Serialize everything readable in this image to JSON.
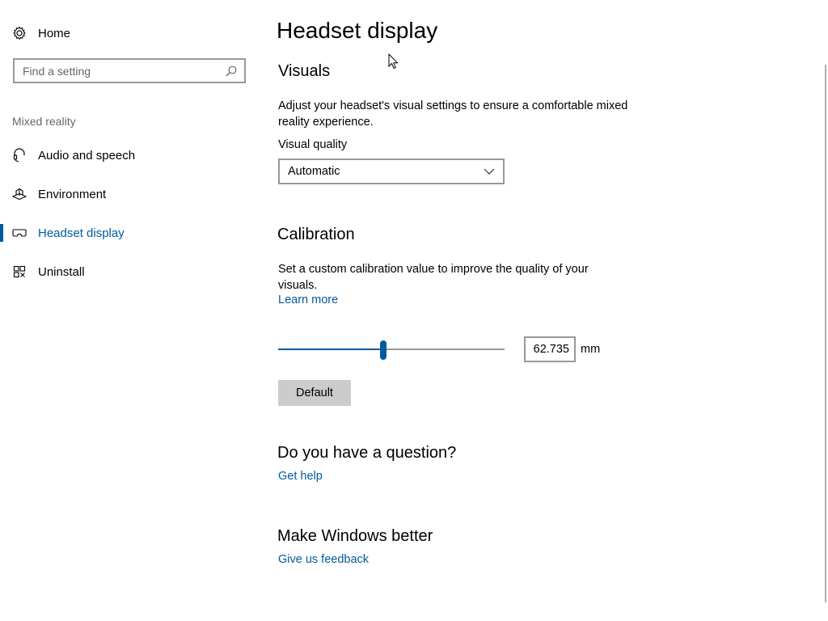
{
  "sidebar": {
    "home_label": "Home",
    "search_placeholder": "Find a setting",
    "section_label": "Mixed reality",
    "items": [
      {
        "label": "Audio and speech",
        "icon": "headset-icon",
        "active": false
      },
      {
        "label": "Environment",
        "icon": "environment-icon",
        "active": false
      },
      {
        "label": "Headset display",
        "icon": "headset-display-icon",
        "active": true
      },
      {
        "label": "Uninstall",
        "icon": "uninstall-icon",
        "active": false
      }
    ]
  },
  "main": {
    "title": "Headset display",
    "visuals": {
      "heading": "Visuals",
      "description": "Adjust your headset's visual settings to ensure a comfortable mixed reality experience.",
      "quality_label": "Visual quality",
      "quality_value": "Automatic"
    },
    "calibration": {
      "heading": "Calibration",
      "description": "Set a custom calibration value to improve the quality of your visuals.",
      "learn_more": "Learn more",
      "slider_fraction": 0.466,
      "value": "62.735",
      "unit": "mm",
      "default_button": "Default"
    },
    "question": {
      "heading": "Do you have a question?",
      "link": "Get help"
    },
    "feedback": {
      "heading": "Make Windows better",
      "link": "Give us feedback"
    }
  },
  "colors": {
    "accent": "#005a9e",
    "border": "#999999",
    "button_bg": "#cccccc",
    "secondary_text": "#666666"
  }
}
